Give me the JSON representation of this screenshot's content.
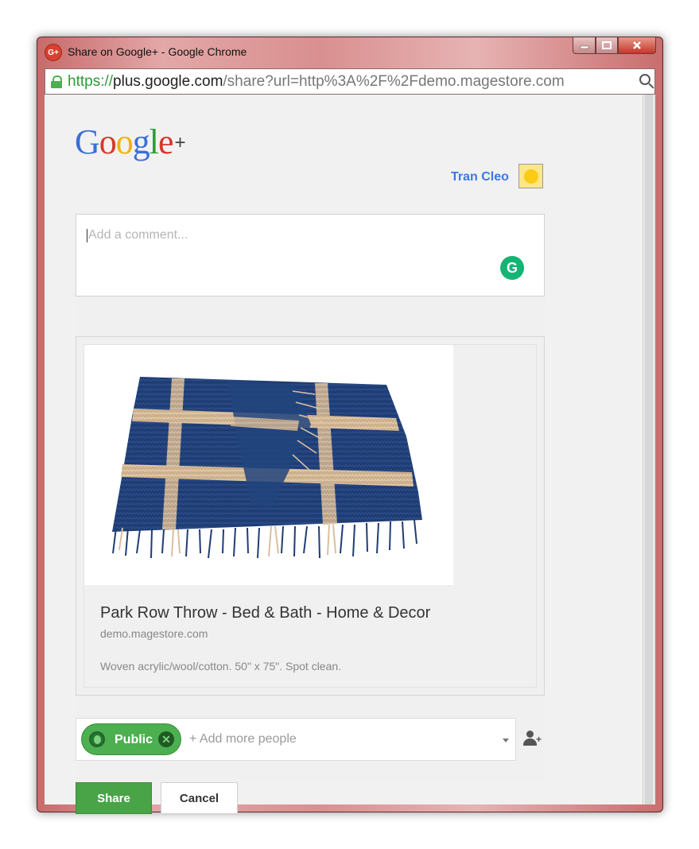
{
  "window": {
    "title": "Share on Google+ - Google Chrome",
    "icon": "google-plus-icon",
    "controls": [
      "minimize",
      "maximize",
      "close"
    ]
  },
  "addressbar": {
    "scheme": "https://",
    "domain": "plus.google.com",
    "path": "/share?url=http%3A%2F%2Fdemo.magestore.com"
  },
  "header": {
    "logo_letters": [
      "G",
      "o",
      "o",
      "g",
      "l",
      "e"
    ],
    "logo_plus": "+",
    "user_name": "Tran Cleo"
  },
  "comment": {
    "placeholder": "Add a comment..."
  },
  "preview": {
    "title": "Park Row Throw - Bed & Bath - Home & Decor",
    "domain": "demo.magestore.com",
    "description": "Woven acrylic/wool/cotton. 50\" x 75\". Spot clean."
  },
  "audience": {
    "chip_label": "Public",
    "add_placeholder": "+ Add more people"
  },
  "actions": {
    "share_label": "Share",
    "cancel_label": "Cancel"
  },
  "colors": {
    "share_green": "#48a446",
    "user_link": "#3b78e7",
    "throw_blue": "#1f3d73",
    "throw_beige": "#d9bfa0"
  }
}
